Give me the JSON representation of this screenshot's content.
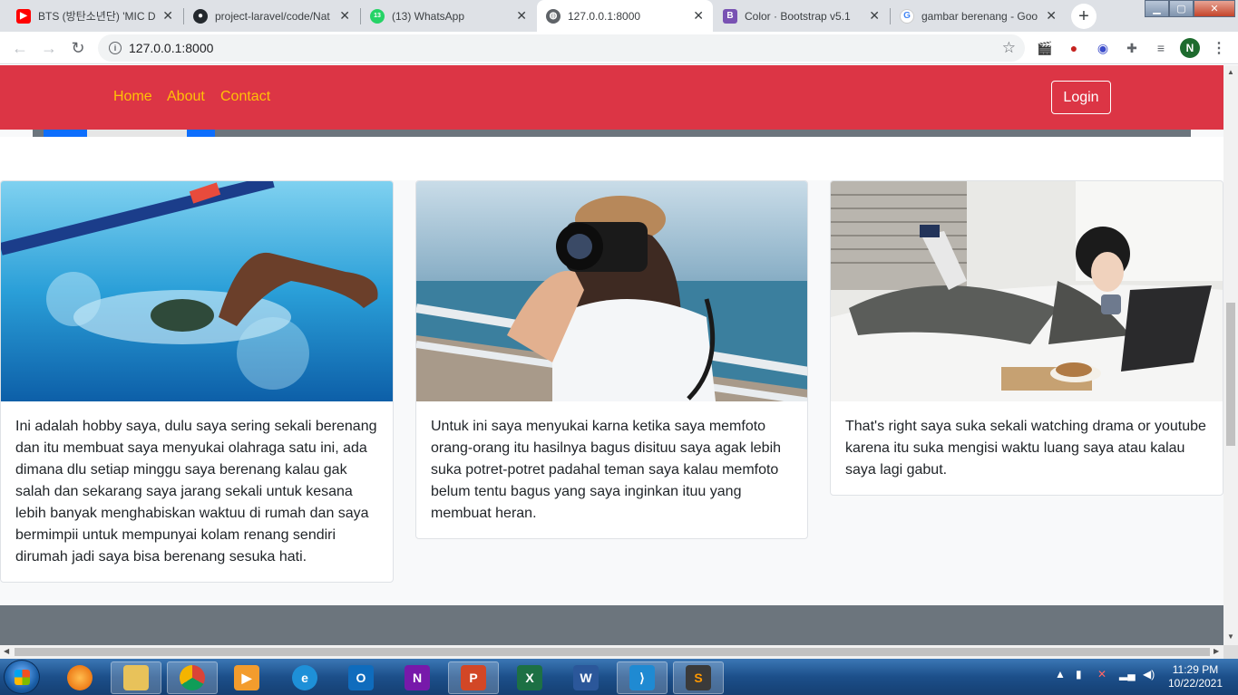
{
  "browser": {
    "tabs": [
      {
        "title": "BTS (방탄소년단) 'MIC D",
        "icon": "youtube-icon",
        "color": "#ff0000"
      },
      {
        "title": "project-laravel/code/Nat",
        "icon": "github-icon",
        "color": "#24292e"
      },
      {
        "title": "(13) WhatsApp",
        "icon": "whatsapp-icon",
        "color": "#25d366",
        "badge": "13"
      },
      {
        "title": "127.0.0.1:8000",
        "icon": "globe-icon",
        "color": "#5f6368",
        "active": true
      },
      {
        "title": "Color · Bootstrap v5.1",
        "icon": "bootstrap-icon",
        "color": "#7952b3",
        "badge": "B"
      },
      {
        "title": "gambar berenang - Goo",
        "icon": "google-icon",
        "color": "#4285f4",
        "badge": "G"
      }
    ],
    "url": "127.0.0.1:8000",
    "profile_initial": "N"
  },
  "page": {
    "nav": {
      "links": [
        "Home",
        "About",
        "Contact"
      ],
      "login": "Login"
    },
    "cards": [
      {
        "image_alt": "swimmer",
        "text": "Ini adalah hobby saya, dulu saya sering sekali berenang dan itu membuat saya menyukai olahraga satu ini, ada dimana dlu setiap minggu saya berenang kalau gak salah dan sekarang saya jarang sekali untuk kesana lebih banyak menghabiskan waktuu di rumah dan saya bermimpii untuk mempunyai kolam renang sendiri dirumah jadi saya bisa berenang sesuka hati."
      },
      {
        "image_alt": "photographer",
        "text": "Untuk ini saya menyukai karna ketika saya memfoto orang-orang itu hasilnya bagus disituu saya agak lebih suka potret-potret padahal teman saya kalau memfoto belum tentu bagus yang saya inginkan ituu yang membuat heran."
      },
      {
        "image_alt": "woman on bed with laptop",
        "text": "That's right saya suka sekali watching drama or youtube karena itu suka mengisi waktu luang saya atau kalau saya lagi gabut."
      }
    ]
  },
  "taskbar": {
    "apps": [
      "Firefox",
      "File Explorer",
      "Chrome",
      "Media Player",
      "Internet Explorer",
      "Outlook",
      "OneNote",
      "PowerPoint",
      "Excel",
      "Word",
      "VS Code",
      "Sublime Text"
    ],
    "time": "11:29 PM",
    "date": "10/22/2021"
  }
}
